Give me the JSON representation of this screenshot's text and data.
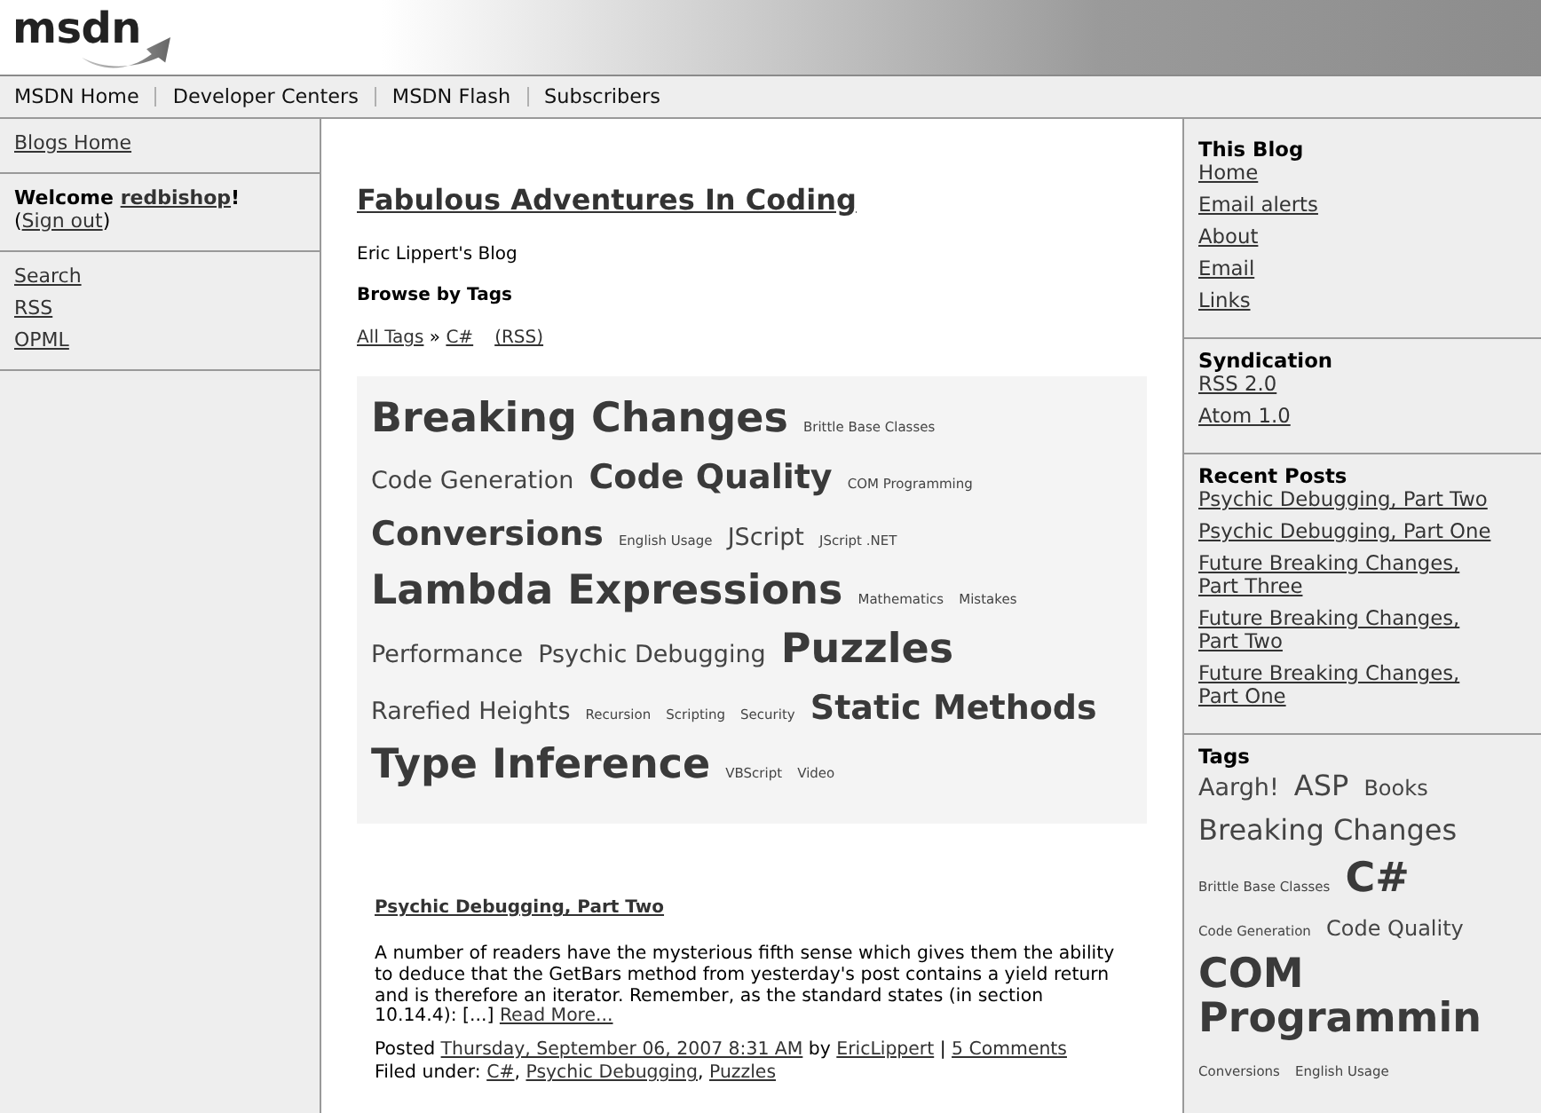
{
  "header": {
    "logo": "msdn"
  },
  "nav": [
    {
      "label": "MSDN Home"
    },
    {
      "label": "Developer Centers"
    },
    {
      "label": "MSDN Flash"
    },
    {
      "label": "Subscribers"
    }
  ],
  "left_sidebar": {
    "sections": [
      {
        "kind": "links",
        "links": [
          "Blogs Home"
        ]
      },
      {
        "kind": "welcome",
        "parts": [
          {
            "kind": "bold",
            "text": "Welcome "
          },
          {
            "kind": "user",
            "text": "redbishop"
          },
          {
            "kind": "bold",
            "text": "!"
          },
          {
            "kind": "text",
            "text": "("
          },
          {
            "kind": "signout",
            "text": "Sign out"
          },
          {
            "kind": "text",
            "text": ")"
          }
        ]
      },
      {
        "kind": "links",
        "links": [
          "Search",
          "RSS",
          "OPML"
        ]
      }
    ]
  },
  "main": {
    "title": "Fabulous Adventures In Coding",
    "subtitle": "Eric Lippert's Blog",
    "browse_heading": "Browse by Tags",
    "breadcrumb": [
      {
        "kind": "crumb",
        "text": "All Tags"
      },
      {
        "kind": "text",
        "text": " » "
      },
      {
        "kind": "crumb",
        "text": "C#"
      },
      {
        "kind": "rss",
        "text": "(RSS)"
      }
    ],
    "tag_cloud": [
      {
        "label": "Breaking Changes",
        "kind": "huge"
      },
      {
        "label": "Brittle Base Classes",
        "kind": "tiny"
      },
      {
        "label": "Code Generation",
        "kind": "medium"
      },
      {
        "label": "Code Quality",
        "kind": "bold"
      },
      {
        "label": "COM Programming",
        "kind": "tiny"
      },
      {
        "label": "Conversions",
        "kind": "bold"
      },
      {
        "label": "English Usage",
        "kind": "tiny"
      },
      {
        "label": "JScript",
        "kind": "medium"
      },
      {
        "label": "JScript .NET",
        "kind": "tiny"
      },
      {
        "label": "Lambda Expressions",
        "kind": "huge"
      },
      {
        "label": "Mathematics",
        "kind": "tiny"
      },
      {
        "label": "Mistakes",
        "kind": "tiny"
      },
      {
        "label": "Performance",
        "kind": "medium"
      },
      {
        "label": "Psychic Debugging",
        "kind": "medium"
      },
      {
        "label": "Puzzles",
        "kind": "huge"
      },
      {
        "label": "Rarefied Heights",
        "kind": "medium"
      },
      {
        "label": "Recursion",
        "kind": "tiny"
      },
      {
        "label": "Scripting",
        "kind": "tiny"
      },
      {
        "label": "Security",
        "kind": "tiny"
      },
      {
        "label": "Static Methods",
        "kind": "bold"
      },
      {
        "label": "Type Inference",
        "kind": "huge"
      },
      {
        "label": "VBScript",
        "kind": "tiny"
      },
      {
        "label": "Video",
        "kind": "tiny"
      }
    ],
    "post": {
      "title": "Psychic Debugging, Part Two",
      "body": [
        {
          "kind": "text",
          "text": "A number of readers have the mysterious fifth sense which gives them the ability to deduce that the GetBars method from yesterday's post contains a yield return and is therefore an iterator. Remember, as the standard states (in section 10.14.4): [...] "
        },
        {
          "kind": "more",
          "text": "Read More..."
        }
      ],
      "posted": [
        {
          "kind": "text",
          "text": "Posted "
        },
        {
          "kind": "date",
          "text": "Thursday, September 06, 2007 8:31 AM"
        },
        {
          "kind": "text",
          "text": " by "
        },
        {
          "kind": "author",
          "text": "EricLippert"
        },
        {
          "kind": "text",
          "text": " | "
        },
        {
          "kind": "comments",
          "text": "5 Comments"
        }
      ],
      "filed": [
        {
          "kind": "text",
          "text": "Filed under: "
        },
        {
          "kind": "tag",
          "text": "C#"
        },
        {
          "kind": "text",
          "text": ", "
        },
        {
          "kind": "tag",
          "text": "Psychic Debugging"
        },
        {
          "kind": "text",
          "text": ", "
        },
        {
          "kind": "tag",
          "text": "Puzzles"
        }
      ]
    }
  },
  "right_sidebar": {
    "sections": [
      {
        "kind": "links",
        "heading": "This Blog",
        "links": [
          "Home",
          "Email alerts",
          "About",
          "Email",
          "Links"
        ]
      },
      {
        "kind": "links",
        "heading": "Syndication",
        "links": [
          "RSS 2.0",
          "Atom 1.0"
        ]
      },
      {
        "kind": "posts",
        "heading": "Recent Posts",
        "links": [
          "Psychic Debugging, Part Two",
          "Psychic Debugging, Part One",
          "Future Breaking Changes, Part Three",
          "Future Breaking Changes, Part Two",
          "Future Breaking Changes, Part One"
        ]
      },
      {
        "kind": "tags",
        "heading": "Tags",
        "tags": [
          {
            "label": "Aargh!",
            "kind": "medium"
          },
          {
            "label": "ASP",
            "kind": "large"
          },
          {
            "label": "Books",
            "kind": "small"
          },
          {
            "label": "Breaking Changes",
            "kind": "large"
          },
          {
            "label": "Brittle Base Classes",
            "kind": "tiny"
          },
          {
            "label": "C#",
            "kind": "huge"
          },
          {
            "label": "Code Generation",
            "kind": "tiny"
          },
          {
            "label": "Code Quality",
            "kind": "small"
          },
          {
            "label": "COM Programmin",
            "kind": "huge"
          },
          {
            "label": "Conversions",
            "kind": "tiny"
          },
          {
            "label": "English Usage",
            "kind": "tiny"
          }
        ]
      }
    ]
  }
}
